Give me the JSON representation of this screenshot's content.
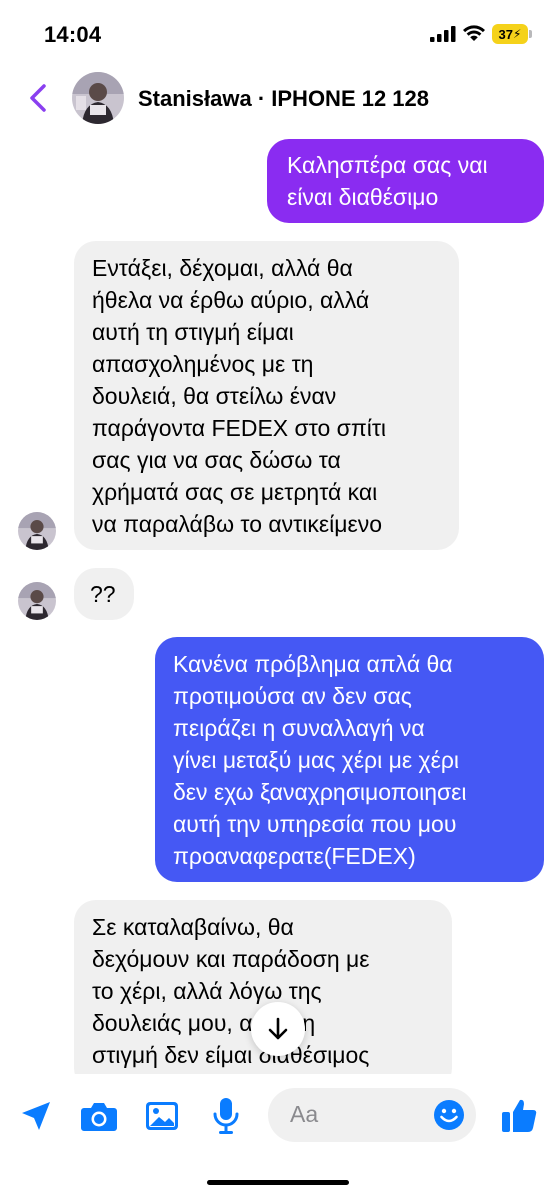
{
  "status_bar": {
    "time": "14:04",
    "battery": "37"
  },
  "header": {
    "contact_title": "Stanisława · IPHONE 12 128"
  },
  "messages": [
    {
      "direction": "outgoing",
      "lines": [
        "Καλησπέρα σας ναι",
        "είναι διαθέσιμο"
      ]
    },
    {
      "direction": "incoming",
      "lines": [
        "Εντάξει, δέχομαι, αλλά θα",
        "ήθελα να έρθω αύριο, αλλά",
        "αυτή τη στιγμή είμαι",
        "απασχολημένος με τη",
        "δουλειά, θα στείλω έναν",
        "παράγοντα FEDEX στο σπίτι",
        "σας για να σας δώσω τα",
        "χρήματά σας σε μετρητά και",
        "να παραλάβω το αντικείμενο"
      ]
    },
    {
      "direction": "incoming",
      "lines": [
        "??"
      ]
    },
    {
      "direction": "outgoing",
      "lines": [
        "Κανένα πρόβλημα απλά θα",
        "προτιμούσα αν δεν σας",
        "πειράζει η συναλλαγή να",
        "γίνει μεταξύ μας χέρι με χέρι",
        "δεν εχω ξαναχρησιμοποιησει",
        "αυτή την υπηρεσία που μου",
        "προαναφερατε(FEDEX)"
      ]
    },
    {
      "direction": "incoming",
      "lines": [
        "Σε καταλαβαίνω, θα",
        "δεχόμουν και παράδοση με",
        "το χέρι, αλλά λόγω της",
        "δουλειάς μου, αυτή τη",
        "στιγμή δεν είμαι διαθέσιμος"
      ]
    }
  ],
  "composer": {
    "placeholder": "Aa"
  },
  "colors": {
    "accent": "#7b2ff7",
    "outgoing_purple": "#8a2cf1",
    "outgoing_blue": "#4558f4",
    "incoming_bg": "#f0f0f0",
    "messenger_blue": "#0a7cff",
    "back_arrow": "#8a3ff0"
  },
  "icons": {
    "back": "chevron-left-icon",
    "send_location": "location-arrow-icon",
    "camera": "camera-icon",
    "gallery": "image-icon",
    "microphone": "microphone-icon",
    "emoji": "emoji-icon",
    "like": "thumbs-up-icon",
    "scroll_down": "arrow-down-icon"
  }
}
